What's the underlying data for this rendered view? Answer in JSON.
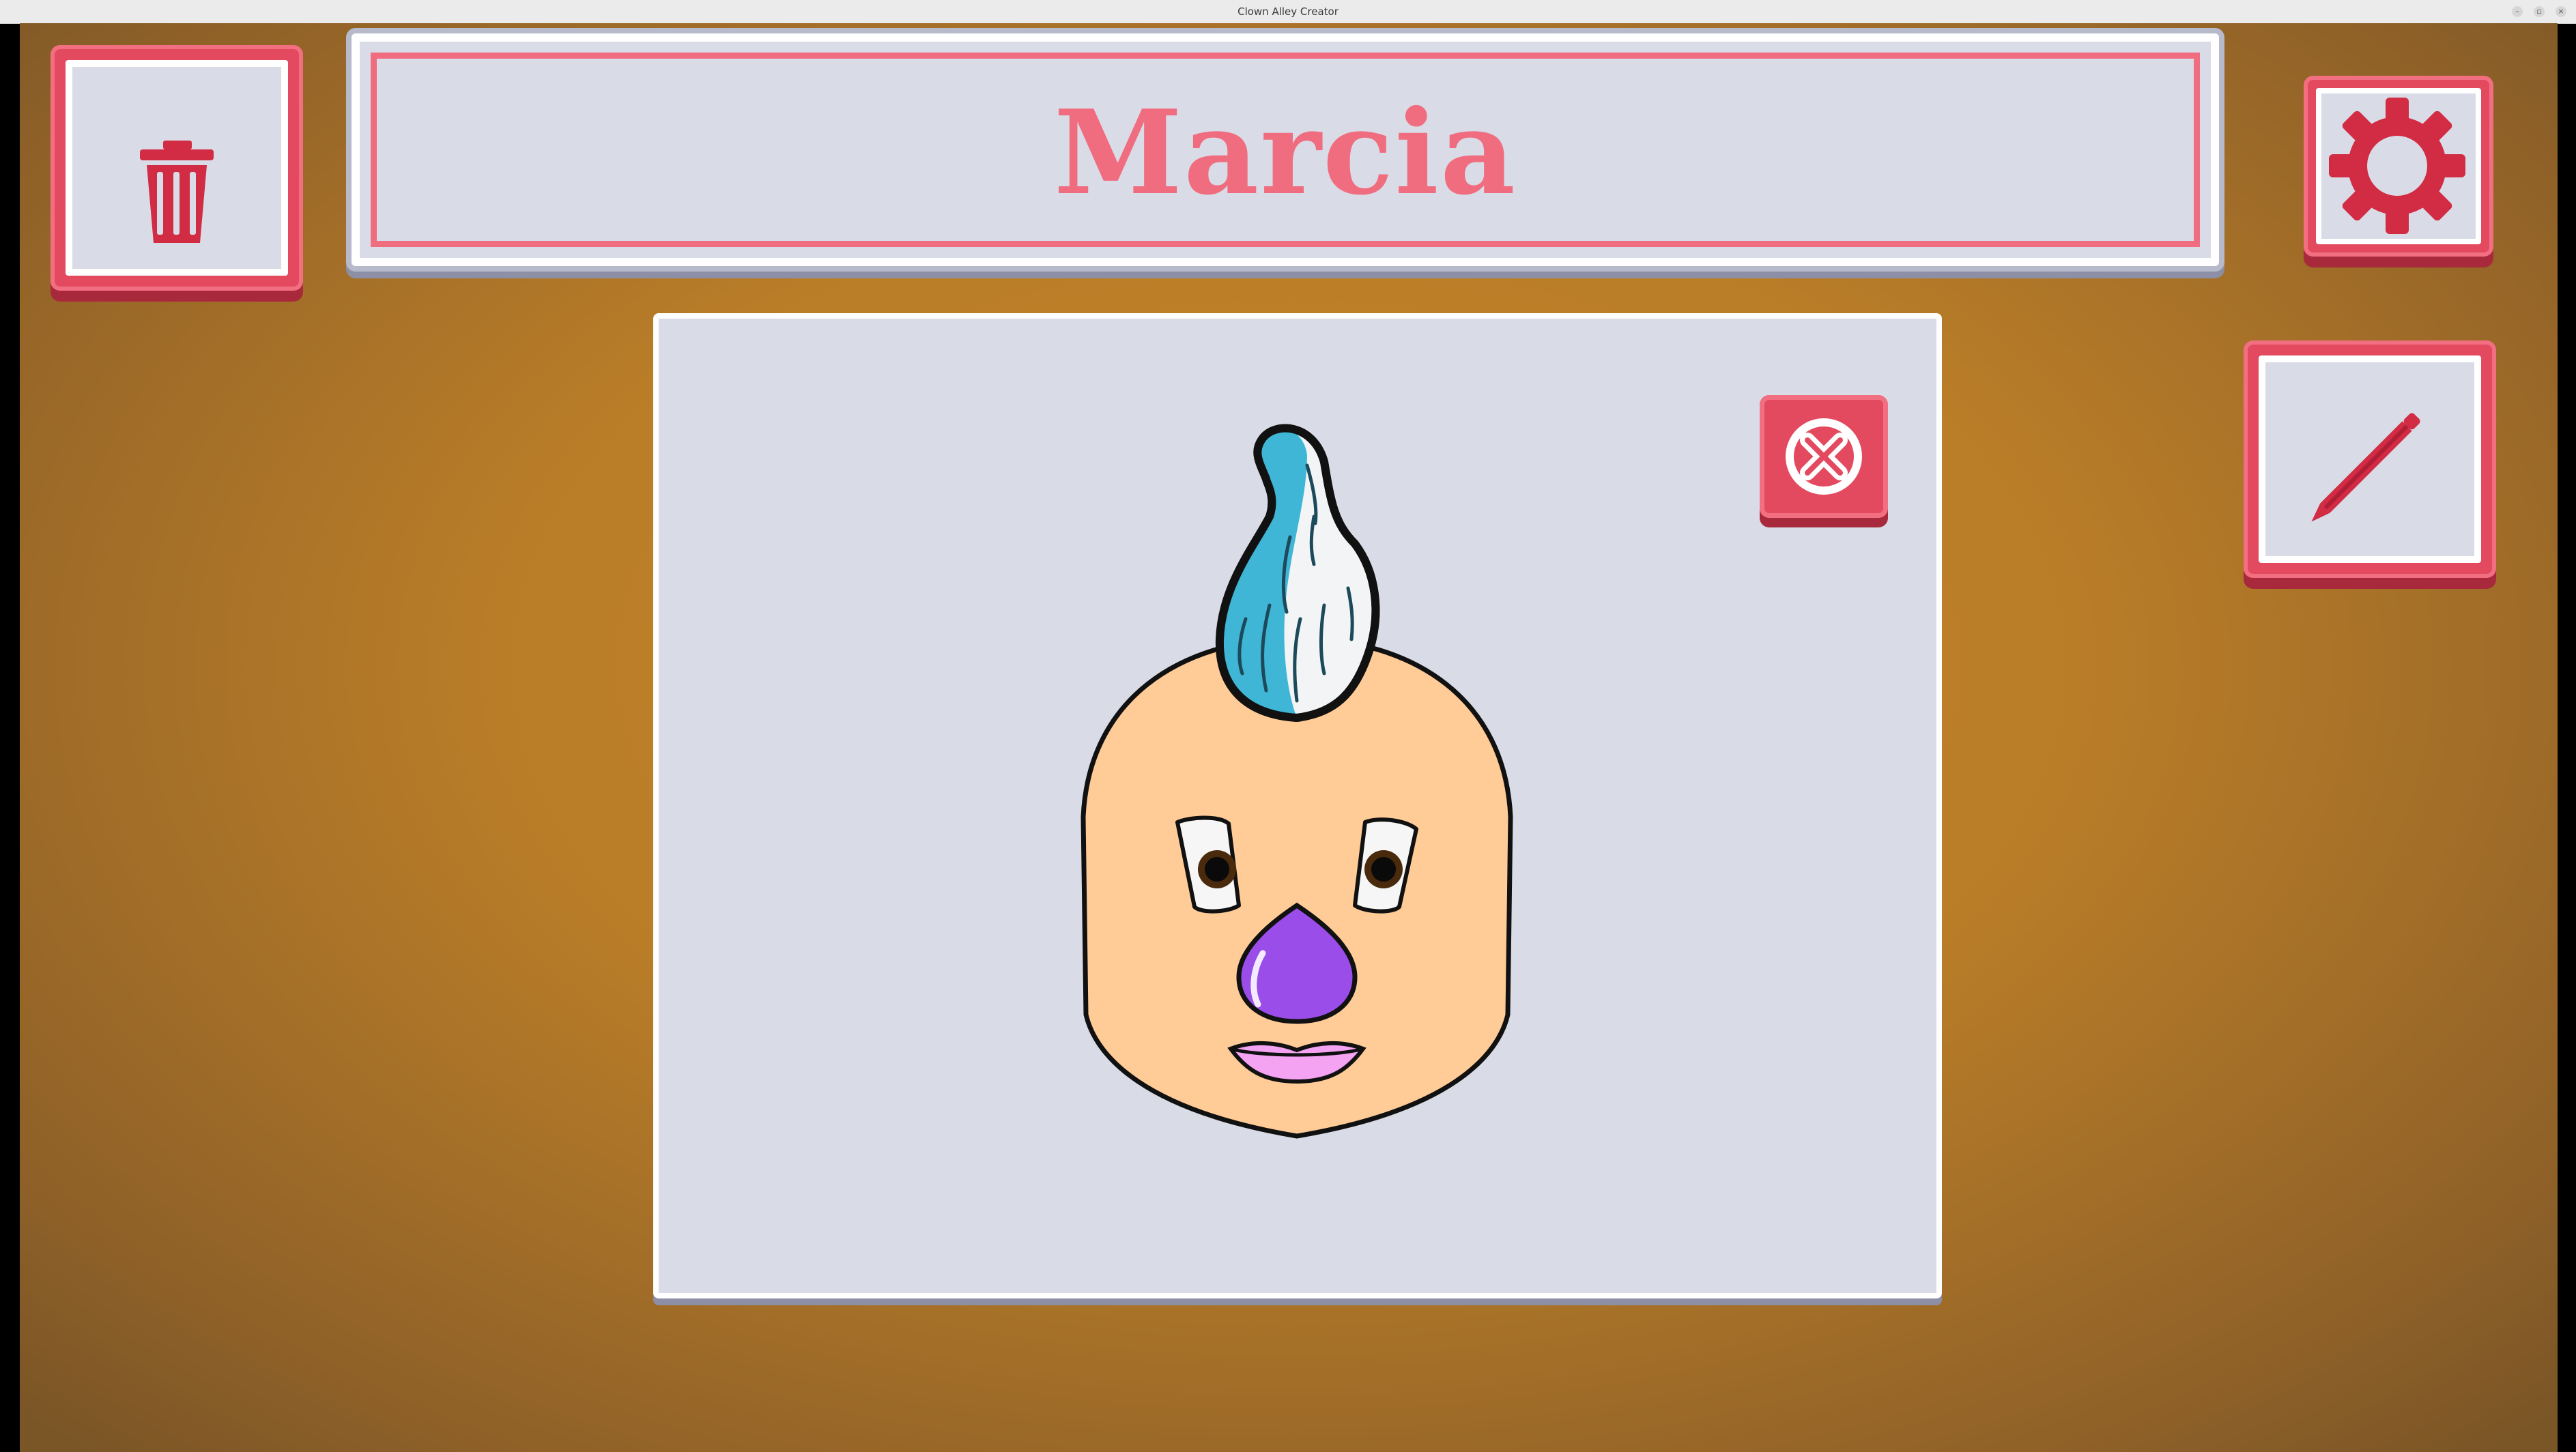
{
  "window": {
    "title": "Clown Alley Creator",
    "controls": {
      "minimize": "–",
      "maximize": "▫",
      "close": "×"
    }
  },
  "toolbar": {
    "delete_icon": "trash-icon",
    "settings_icon": "gear-icon",
    "edit_icon": "pencil-icon"
  },
  "banner": {
    "clown_name": "Marcia"
  },
  "preview": {
    "close_icon": "close-icon",
    "clown": {
      "hair": "swirl-cone",
      "hair_colors": [
        "#3fb6d6",
        "#f3f4f5"
      ],
      "face_color": "#ffcb97",
      "eyes_color": "#4a2a0c",
      "nose_color": "#9a4de8",
      "lips_color": "#f3a3f2"
    }
  },
  "colors": {
    "accent": "#e34a60",
    "accent_light": "#f06d80",
    "panel": "#d9dce7",
    "background": "#c8862a"
  }
}
